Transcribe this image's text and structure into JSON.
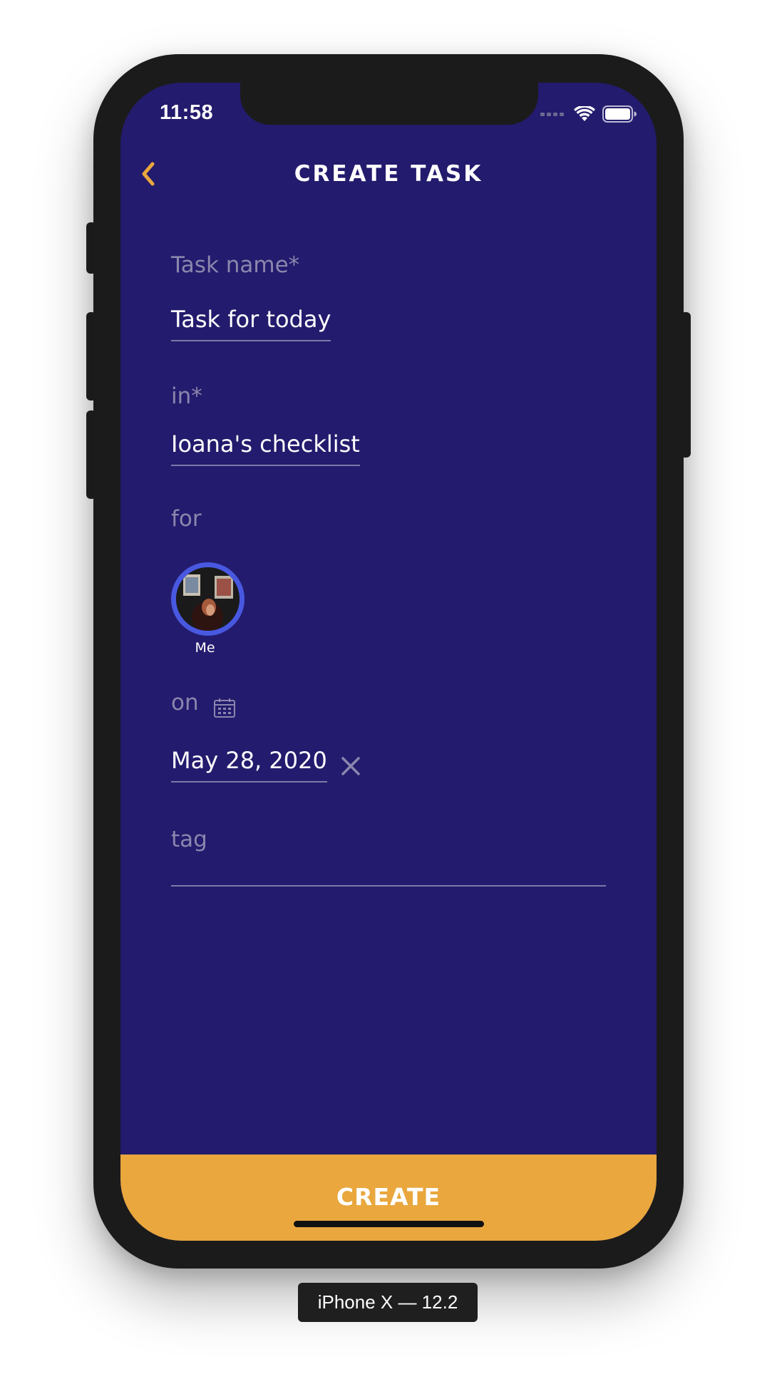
{
  "status_bar": {
    "time": "11:58",
    "icons": [
      "cellular-signal-icon",
      "wifi-icon",
      "battery-icon"
    ]
  },
  "header": {
    "title": "CREATE TASK",
    "back_icon": "chevron-left-icon"
  },
  "form": {
    "task_name": {
      "label": "Task name*",
      "value": "Task for today"
    },
    "checklist": {
      "label": "in*",
      "value": "Ioana's checklist"
    },
    "assignees": {
      "label": "for",
      "people": [
        {
          "name": "Me",
          "avatar": "user-photo"
        }
      ]
    },
    "due_date": {
      "label": "on",
      "icon": "calendar-icon",
      "value": "May 28, 2020",
      "clear_icon": "close-icon"
    },
    "tag": {
      "label": "tag",
      "value": ""
    }
  },
  "footer": {
    "create_label": "CREATE"
  },
  "device_caption": "iPhone X — 12.2",
  "colors": {
    "background": "#231b6d",
    "accent": "#e9a73e",
    "label": "#8b86ad",
    "avatar_ring": "#4858e0"
  }
}
